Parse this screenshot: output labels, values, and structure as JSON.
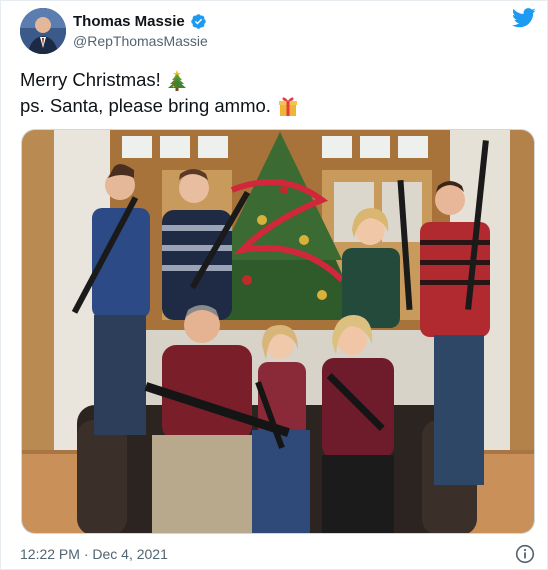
{
  "author": {
    "display_name": "Thomas Massie",
    "handle": "@RepThomasMassie",
    "verified_icon": "verified-badge-icon",
    "avatar_icon": "profile-avatar"
  },
  "tweet": {
    "line1": "Merry Christmas!",
    "line1_emoji": "christmas-tree-emoji",
    "line2": "ps. Santa, please bring ammo.",
    "line2_emoji": "wrapped-gift-emoji",
    "photo_icon": "family-christmas-photo"
  },
  "footer": {
    "timestamp": "12:22 PM · Dec 4, 2021",
    "info_icon": "info-icon"
  },
  "colors": {
    "brand_blue": "#1d9bf0",
    "text_primary": "#0f1419",
    "text_secondary": "#536471"
  }
}
